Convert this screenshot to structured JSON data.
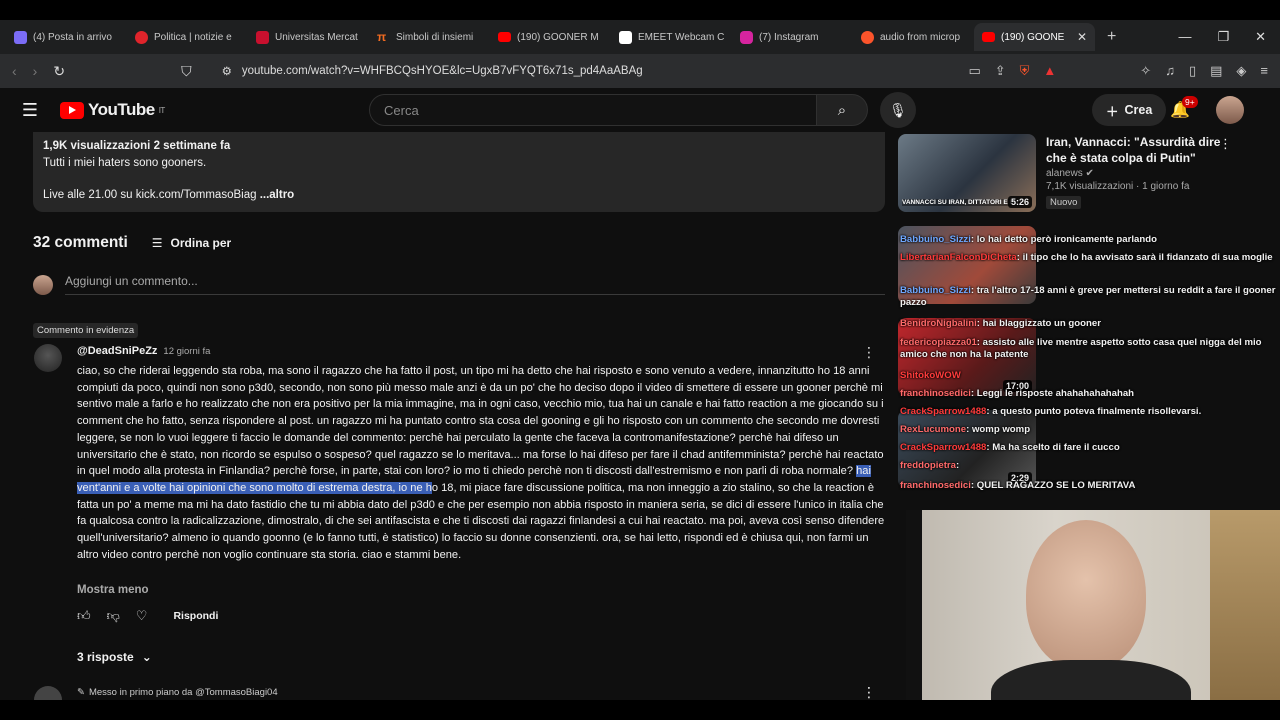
{
  "browser": {
    "tabs": [
      {
        "label": "(4) Posta in arrivo",
        "icon": "gmail-icon",
        "color": "#7b6cf6"
      },
      {
        "label": "Politica | notizie e",
        "icon": "news-icon",
        "color": "#e0242b"
      },
      {
        "label": "Universitas Mercat",
        "icon": "university-icon",
        "color": "#c8102e"
      },
      {
        "label": "Simboli di insiemi",
        "icon": "pi-icon",
        "color": "#f26b21"
      },
      {
        "label": "(190) GOONER M",
        "icon": "youtube-icon",
        "color": "#ff0000"
      },
      {
        "label": "EMEET Webcam C",
        "icon": "amazon-icon",
        "color": "#ffffff"
      },
      {
        "label": "(7) Instagram",
        "icon": "instagram-icon",
        "color": "#d6249f"
      },
      {
        "label": "audio from microp",
        "icon": "brave-icon",
        "color": "#fb542b"
      },
      {
        "label": "(190) GOONE",
        "icon": "youtube-icon",
        "color": "#ff0000",
        "active": true
      }
    ],
    "url": "youtube.com/watch?v=WHFBCQsHYOE&lc=UgxB7vFYQT6x71s_pd4AaABAg"
  },
  "header": {
    "logo_text": "YouTube",
    "logo_country": "IT",
    "search_placeholder": "Cerca",
    "create_label": "Crea",
    "notifications_badge": "9+"
  },
  "description": {
    "meta": "1,9K visualizzazioni  2 settimane fa",
    "line1": "Tutti i miei haters sono gooners.",
    "line2": "Live alle 21.00 su kick.com/TommasoBiag",
    "more": " ...altro"
  },
  "comments": {
    "count_label": "32 commenti",
    "sort_label": "Ordina per",
    "add_placeholder": "Aggiungi un commento...",
    "pinned_label": "Commento in evidenza",
    "top": {
      "author": "@DeadSniPeZz",
      "date": "12 giorni fa",
      "text_before": "ciao, so che riderai leggendo sta roba, ma sono il ragazzo che ha fatto il post, un tipo mi ha detto che hai risposto e sono venuto a vedere, innanzitutto ho 18 anni compiuti da poco, quindi non sono p3d0, secondo, non sono più messo male anzi è da un po' che ho deciso dopo il video di smettere di essere un gooner perchè mi sentivo male a farlo e ho realizzato che non era positivo per la mia immagine, ma in ogni caso, vecchio mio, tua hai un canale e hai fatto reaction a me giocando su i comment che ho fatto, senza rispondere al post. un ragazzo mi ha puntato contro sta cosa del gooning e gli ho risposto con un commento che secondo me dovresti leggere, se non lo vuoi leggere ti faccio le domande del commento: perchè hai perculato la gente che faceva la contromanifestazione? perchè hai difeso un universitario che è stato, non ricordo se espulso o sospeso? quel ragazzo se lo meritava... ma forse lo hai difeso per fare il chad antifemminista? perchè hai reactato in quel modo alla protesta in Finlandia? perchè forse, in parte, stai con loro? io mo ti chiedo perchè non ti discosti dall'estremismo e non parli di roba normale? ",
      "text_highlight": "hai vent'anni e a volte hai opinioni che sono molto di estrema destra, io ne h",
      "text_after": "o 18, mi piace fare discussione politica, ma non inneggio a zio stalino, so che la reaction è fatta un po' a meme ma mi ha dato fastidio che tu mi abbia dato del p3d0 e che per esempio non abbia risposto in maniera seria, se dici di essere l'unico in italia che fa qualcosa contro la radicalizzazione, dimostralo, di che sei antifascista e che ti discosti dai ragazzi finlandesi a cui hai reactato. ma poi, aveva così senso difendere quell'universitario? almeno io quando goonno (e lo fanno tutti, è statistico) lo faccio su donne consenzienti. ora, se hai letto, rispondi ed è chiusa qui, non farmi un altro video contro perchè non voglio continuare sta storia. ciao e stammi bene.",
      "show_less": "Mostra meno",
      "reply_label": "Rispondi",
      "replies_label": "3 risposte"
    },
    "next_pinned_label": "Messo in primo piano da @TommasoBiagi04"
  },
  "sidebar": {
    "video1": {
      "title": "Iran, Vannacci: \"Assurdità dire che è stata colpa di Putin\"",
      "channel": "alanews",
      "meta": "7,1K visualizzazioni · 1 giorno fa",
      "badge": "Nuovo",
      "duration": "5:26",
      "thumb_caption": "VANNACCI SU IRAN, DITTATORI E PUT"
    },
    "video3_duration": "17:00",
    "video4_duration": "2:29"
  },
  "chat": [
    {
      "user": "Babbuino_Sizzi",
      "msg": ": lo hai detto però ironicamente parlando",
      "cls": "blue"
    },
    {
      "user": "LibertarianFalconDiCheta",
      "msg": ": il tipo che lo ha avvisato sarà il fidanzato di sua moglie",
      "cls": "red2"
    },
    {
      "user": "Babbuino_Sizzi",
      "msg": ": tra l'altro 17-18 anni è greve per mettersi su reddit a fare il gooner pazzo",
      "cls": "blue"
    },
    {
      "user": "BenidroNigbalini",
      "msg": ": hai blaggizzato un gooner",
      "cls": ""
    },
    {
      "user": "federicopiazza01",
      "msg": ": assisto alle live mentre aspetto sotto casa quel nigga del mio amico che non ha la patente",
      "cls": ""
    },
    {
      "user": "ShitokoWOW",
      "msg": "",
      "cls": "red2"
    },
    {
      "user": "franchinosedici",
      "msg": ": Leggi le risposte ahahahahahahah",
      "cls": ""
    },
    {
      "user": "CrackSparrow1488",
      "msg": ": a questo punto poteva finalmente risollevarsi.",
      "cls": "red2"
    },
    {
      "user": "RexLucumone",
      "msg": ": womp womp",
      "cls": ""
    },
    {
      "user": "CrackSparrow1488",
      "msg": ": Ma ha scelto di fare il cucco",
      "cls": "red2"
    },
    {
      "user": "freddopietra",
      "msg": ":",
      "cls": ""
    },
    {
      "user": "franchinosedici",
      "msg": ": QUEL RAGAZZO SE LO MERITAVA",
      "cls": ""
    }
  ]
}
